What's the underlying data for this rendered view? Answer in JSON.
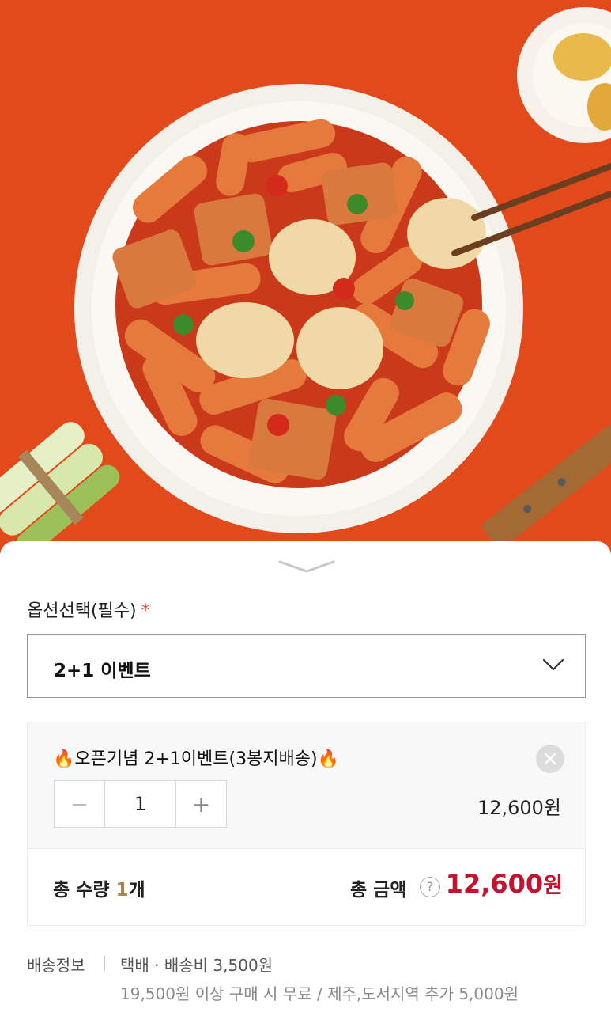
{
  "option": {
    "label": "옵션선택(필수)",
    "required_mark": "*",
    "selected": "2+1 이벤트"
  },
  "item": {
    "name": "🔥오픈기념 2+1이벤트(3봉지배송)🔥",
    "minus": "−",
    "plus": "+",
    "quantity": "1",
    "price": "12,600원"
  },
  "totals": {
    "qty_label": "총 수량 ",
    "qty_value": "1",
    "qty_unit": "개",
    "amount_label": "총 금액",
    "help": "?",
    "amount_value": "12,600",
    "amount_unit": "원"
  },
  "shipping": {
    "label": "배송정보",
    "line1": "택배 · 배송비 3,500원",
    "line2": "19,500원 이상 구매 시 무료 / 제주,도서지역 추가 5,000원"
  },
  "colors": {
    "accent_price": "#c4122f",
    "qty_highlight": "#a9884e",
    "required_star": "#e0463a",
    "hero_background": "#e24a1c"
  },
  "icons": {
    "select_chevron": "chevron-down-icon",
    "sheet_handle": "chevron-down-icon",
    "remove_item": "close-icon",
    "help": "question-icon"
  }
}
